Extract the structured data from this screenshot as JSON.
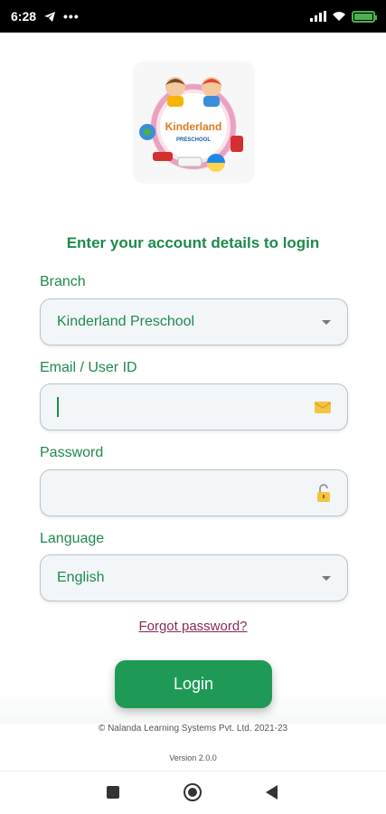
{
  "status_bar": {
    "time": "6:28",
    "battery_level": 1.0
  },
  "logo": {
    "title": "Kinderland",
    "subtitle": "PRESCHOOL"
  },
  "headline": "Enter your account details to login",
  "branch": {
    "label": "Branch",
    "value": "Kinderland Preschool"
  },
  "email": {
    "label": "Email / User ID",
    "value": "",
    "icon": "envelope-icon"
  },
  "password": {
    "label": "Password",
    "value": "",
    "icon": "unlocked-padlock-icon"
  },
  "language": {
    "label": "Language",
    "value": "English"
  },
  "forgot_password": "Forgot password?",
  "login_button": "Login",
  "footer": {
    "copyright": "© Nalanda Learning Systems Pvt. Ltd. 2021-23",
    "version": "Version 2.0.0"
  },
  "colors": {
    "primary_green": "#1f8a4c",
    "button_green": "#1f9a56",
    "link": "#8a2a55",
    "status_bar": "#000000"
  }
}
